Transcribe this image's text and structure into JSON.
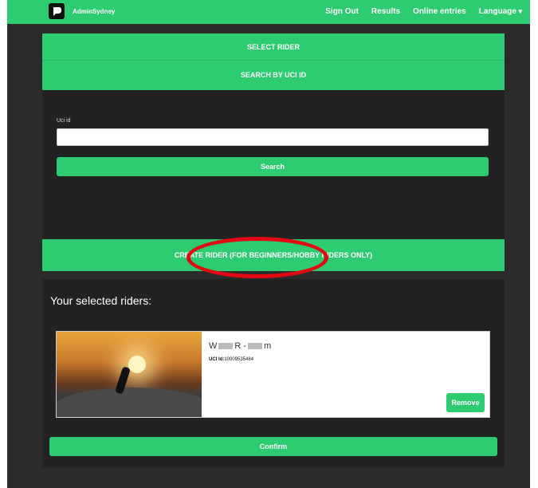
{
  "navbar": {
    "brand": "AdminSydney",
    "links": [
      "Sign Out",
      "Results",
      "Online entries",
      "Language"
    ]
  },
  "select_panel": {
    "select_rider": "SELECT RIDER",
    "search_by_uci": "SEARCH BY UCI ID",
    "uci_label": "Uci id",
    "uci_value": "",
    "search_button": "Search",
    "create_rider": "CREATE RIDER (FOR BEGINNERS/HOBBY RIDERS ONLY)"
  },
  "selected_panel": {
    "title": "Your selected riders:",
    "rider": {
      "name_first": "W",
      "name_mid": "R -",
      "name_last": "m",
      "uci_label": "UCI Id:",
      "uci_value": "10009535484"
    },
    "remove_button": "Remove",
    "confirm_button": "Confirm"
  },
  "colors": {
    "accent": "#2ecc71",
    "dark_bg": "#2b2b2b",
    "panel_bg": "#222222",
    "highlight": "#e30613"
  }
}
